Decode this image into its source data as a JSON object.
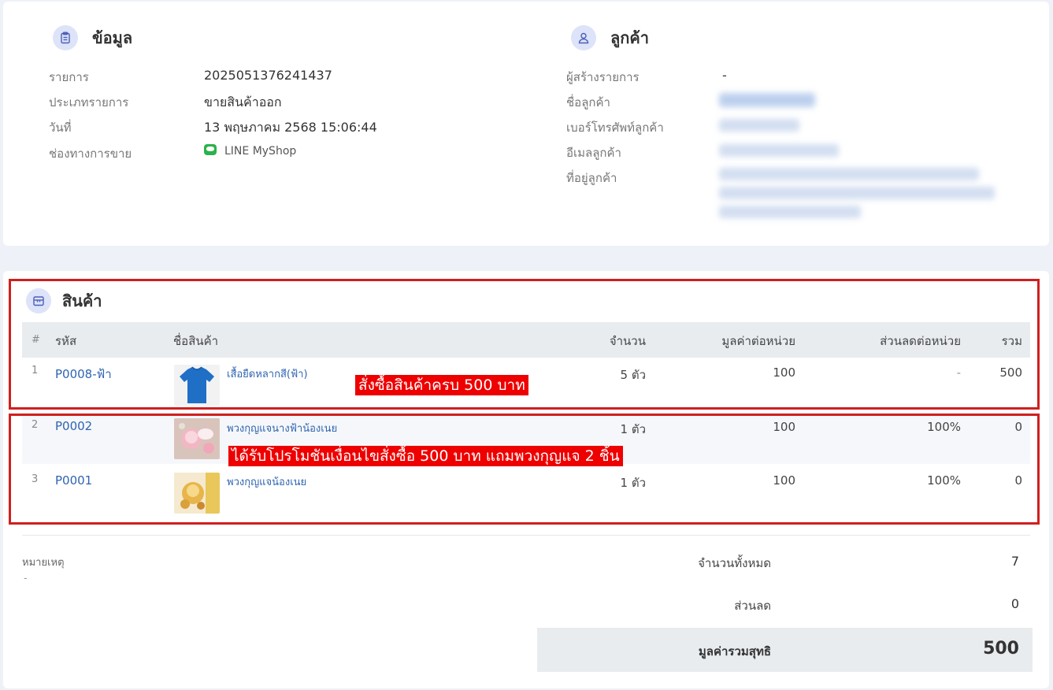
{
  "info": {
    "title": "ข้อมูล",
    "rows": [
      {
        "label": "รายการ",
        "value": "2025051376241437"
      },
      {
        "label": "ประเภทรายการ",
        "value": "ขายสินค้าออก"
      },
      {
        "label": "วันที่",
        "value": "13 พฤษภาคม 2568 15:06:44"
      },
      {
        "label": "ช่องทางการขาย",
        "value": "LINE MyShop"
      }
    ]
  },
  "customer": {
    "title": "ลูกค้า",
    "rows": [
      {
        "label": "ผู้สร้างรายการ",
        "value": "-"
      },
      {
        "label": "ชื่อลูกค้า"
      },
      {
        "label": "เบอร์โทรศัพท์ลูกค้า"
      },
      {
        "label": "อีเมลลูกค้า"
      },
      {
        "label": "ที่อยู่ลูกค้า"
      }
    ]
  },
  "products": {
    "title": "สินค้า",
    "columns": [
      "#",
      "รหัส",
      "ชื่อสินค้า",
      "จำนวน",
      "มูลค่าต่อหน่วย",
      "ส่วนลดต่อหน่วย",
      "รวม"
    ],
    "rows": [
      {
        "index": "1",
        "code": "P0008-ฟ้า",
        "name": "เสื้อยืดหลากสี(ฟ้า)",
        "qty": "5 ตัว",
        "unit_price": "100",
        "discount": "-",
        "total": "500"
      },
      {
        "index": "2",
        "code": "P0002",
        "name": "พวงกุญแจนางฟ้าน้องเนย",
        "qty": "1 ตัว",
        "unit_price": "100",
        "discount": "100%",
        "total": "0"
      },
      {
        "index": "3",
        "code": "P0001",
        "name": "พวงกุญแจน้องเนย",
        "qty": "1 ตัว",
        "unit_price": "100",
        "discount": "100%",
        "total": "0"
      }
    ],
    "annotations": {
      "purchase": "สั่งซื้อสินค้าครบ 500 บาท",
      "promo": "ได้รับโปรโมชันเงื่อนไขสั่งซื้อ 500 บาท แถมพวงกุญแจ 2 ชิ้น"
    },
    "colors": {
      "annotation_red": "#d01f1f"
    }
  },
  "note": {
    "label": "หมายเหตุ",
    "value": "-"
  },
  "summary": {
    "total_qty_label": "จำนวนทั้งหมด",
    "total_qty": "7",
    "discount_label": "ส่วนลด",
    "discount": "0",
    "net_label": "มูลค่ารวมสุทธิ",
    "net": "500"
  }
}
